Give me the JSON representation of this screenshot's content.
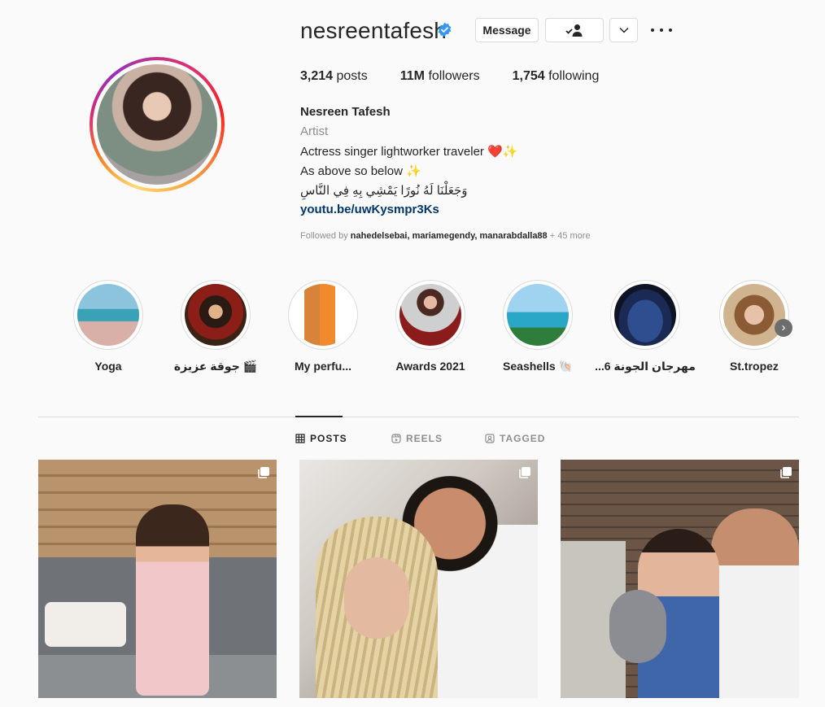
{
  "profile": {
    "username": "nesreentafesh",
    "verified_icon": "verified-badge-icon",
    "message_label": "Message",
    "stats": {
      "posts": "3,214",
      "posts_label": "posts",
      "followers": "11M",
      "followers_label": "followers",
      "following": "1,754",
      "following_label": "following"
    },
    "full_name": "Nesreen Tafesh",
    "category": "Artist",
    "bio_line1": "Actress singer lightworker traveler ❤️✨",
    "bio_line2": "As above so below ✨",
    "bio_line3": "وَجَعَلْنَا لَهُ نُورًا يَمْشِي بِهِ فِي النَّاسِ",
    "link": "youtu.be/uwKysmpr3Ks",
    "followed_by_prefix": "Followed by ",
    "followed_by_names": "nahedelsebai, mariamegendy, manarabdalla88",
    "followed_by_more": " + 45 more"
  },
  "highlights": [
    {
      "label": "Yoga"
    },
    {
      "label": "جوقة عزيزة 🎬"
    },
    {
      "label": "My perfu..."
    },
    {
      "label": "Awards 2021"
    },
    {
      "label": "Seashells 🐚"
    },
    {
      "label": "مهرجان الجونة 6..."
    },
    {
      "label": "St.tropez"
    }
  ],
  "tabs": {
    "posts": "POSTS",
    "reels": "REELS",
    "tagged": "TAGGED"
  },
  "colors": {
    "link": "#00376b",
    "verified": "#3897f0",
    "muted": "#8e8e8e"
  }
}
